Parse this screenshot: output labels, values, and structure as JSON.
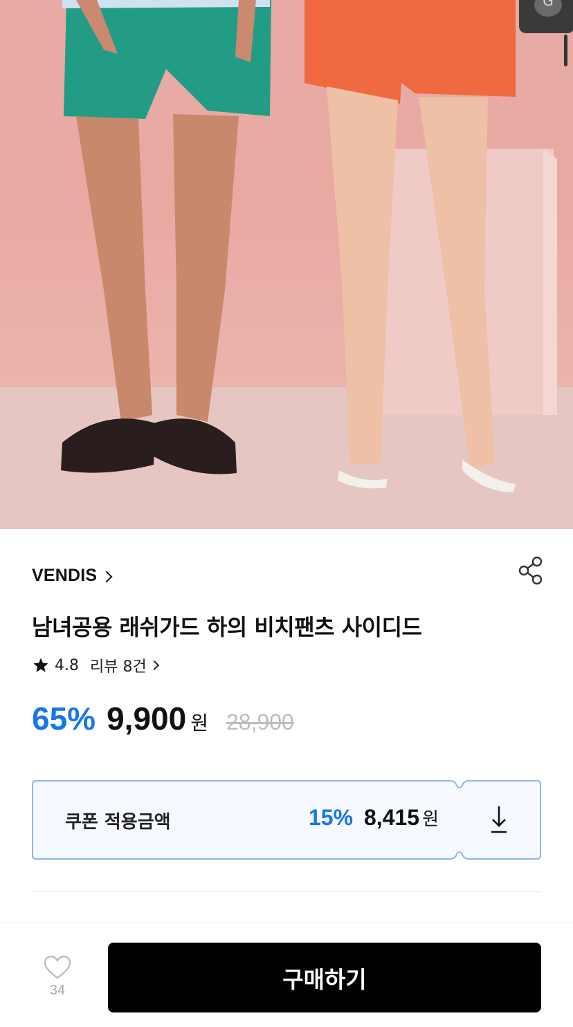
{
  "overlay": {
    "badge_letter": "G"
  },
  "product": {
    "brand": "VENDIS",
    "title": "남녀공용 래쉬가드 하의 비치팬츠 사이디드",
    "rating": "4.8",
    "review_text": "리뷰 8건",
    "discount_rate": "65%",
    "price": "9,900",
    "currency": "원",
    "original_price": "28,900"
  },
  "coupon": {
    "label": "쿠폰 적용금액",
    "rate": "15%",
    "price": "8,415",
    "currency": "원"
  },
  "bottom_bar": {
    "like_count": "34",
    "buy_label": "구매하기"
  },
  "colors": {
    "accent": "#1976e8",
    "coupon_border": "#8fb4e8",
    "coupon_bg": "#f6f9ff",
    "buy_button": "#000000"
  },
  "icons": [
    "share-icon",
    "star-icon",
    "chevron-right-icon",
    "download-icon",
    "heart-icon"
  ]
}
